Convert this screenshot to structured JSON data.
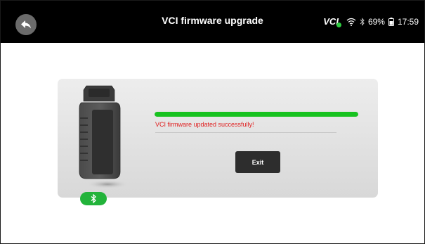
{
  "header": {
    "title": "VCI firmware upgrade",
    "back_icon": "back-arrow-icon"
  },
  "status_bar": {
    "vci_label": "VCI",
    "vci_connected_color": "#2ecc40",
    "wifi_icon": "wifi-icon",
    "bluetooth_icon": "bluetooth-icon",
    "battery_percent": "69%",
    "battery_icon": "battery-icon",
    "time": "17:59"
  },
  "main": {
    "device_image": "vci-dongle",
    "bluetooth_badge_icon": "bluetooth-icon",
    "bluetooth_badge_color": "#22b33a",
    "progress": {
      "value": 1.0,
      "color": "#17c21f"
    },
    "message": "VCI firmware updated successfully!",
    "message_color": "#e01e1e",
    "exit_label": "Exit"
  }
}
